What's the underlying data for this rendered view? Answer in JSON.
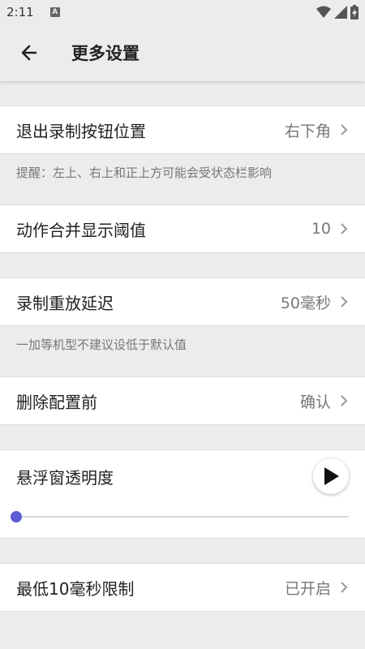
{
  "status": {
    "time": "2:11",
    "notif_glyph": "A"
  },
  "appbar": {
    "title": "更多设置"
  },
  "rows": {
    "exit_button": {
      "label": "退出录制按钮位置",
      "value": "右下角"
    },
    "merge_threshold": {
      "label": "动作合并显示阈值",
      "value": "10"
    },
    "replay_delay": {
      "label": "录制重放延迟",
      "value": "50毫秒"
    },
    "delete_config": {
      "label": "删除配置前",
      "value": "确认"
    },
    "min_limit": {
      "label": "最低10毫秒限制",
      "value": "已开启"
    }
  },
  "hints": {
    "exit_button": "提醒：左上、右上和正上方可能会受状态栏影响",
    "replay_delay": "一加等机型不建议设低于默认值"
  },
  "opacity": {
    "label": "悬浮窗透明度",
    "level": 0.0
  },
  "colors": {
    "accent": "#5b5bd6",
    "background": "#ececec"
  },
  "icons": [
    "back-arrow-icon",
    "chevron-right-icon",
    "play-icon",
    "wifi-icon",
    "signal-icon",
    "battery-icon"
  ]
}
